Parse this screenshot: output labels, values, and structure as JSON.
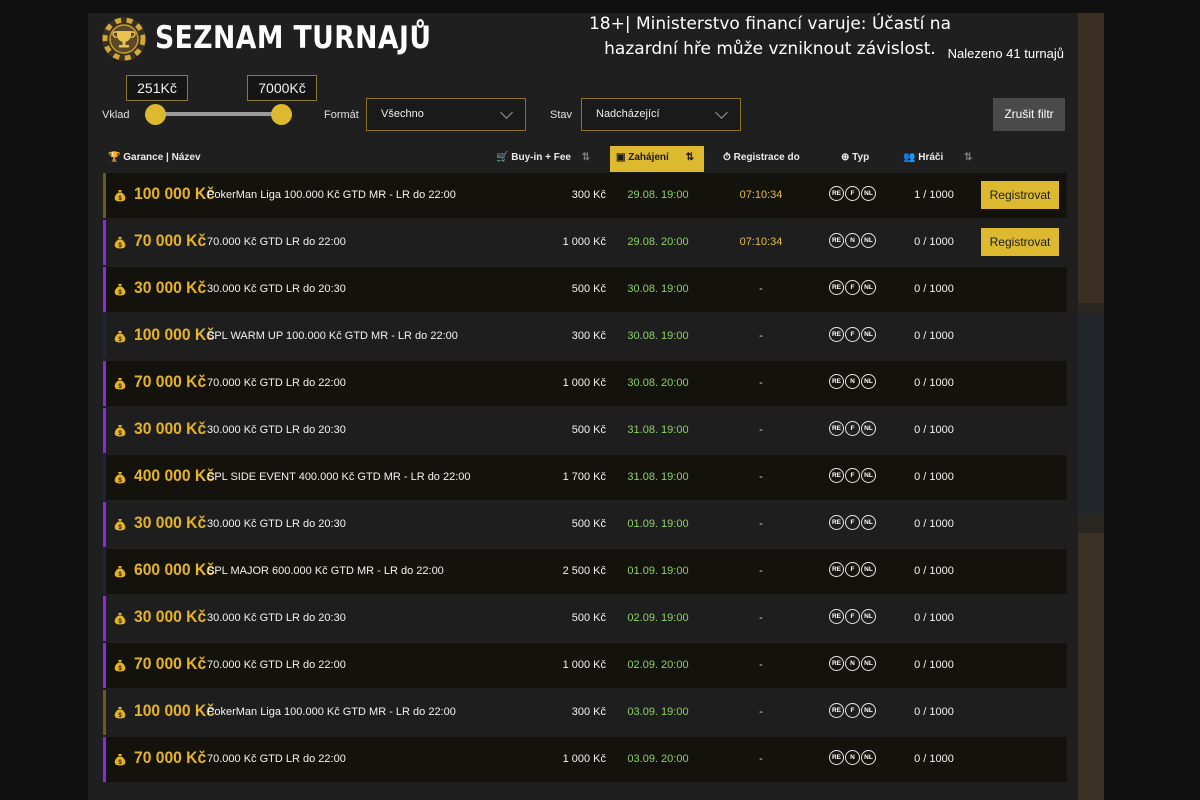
{
  "header": {
    "title": "SEZNAM TURNAJŮ",
    "warning": "18+| Ministerstvo financí varuje: Účastí na hazardní hře může vzniknout závislost.",
    "found": "Nalezeno 41 turnajů"
  },
  "filters": {
    "min_price": "251Kč",
    "max_price": "7000Kč",
    "deposit_label": "Vklad",
    "format_label": "Formát",
    "format_value": "Všechno",
    "status_label": "Stav",
    "status_value": "Nadcházející",
    "clear_button": "Zrušit filtr"
  },
  "table": {
    "headers": {
      "name": "Garance | Název",
      "buyin": "Buy-in + Fee",
      "start": "Zahájení",
      "reg": "Registrace do",
      "type": "Typ",
      "players": "Hráči"
    },
    "register_label": "Registrovat",
    "rows": [
      {
        "amount": "100 000 Kč",
        "name": "PokerMan Liga 100.000 Kč GTD MR - LR do 22:00",
        "buyin": "300 Kč",
        "start": "29.08. 19:00",
        "reg_until": "07:10:34",
        "types": [
          "RE",
          "F",
          "NL"
        ],
        "players": "1 / 1000",
        "register": true,
        "stripe": "gold"
      },
      {
        "amount": "70 000 Kč",
        "name": "70.000 Kč GTD LR do 22:00",
        "buyin": "1 000 Kč",
        "start": "29.08. 20:00",
        "reg_until": "07:10:34",
        "types": [
          "RE",
          "N",
          "NL"
        ],
        "players": "0 / 1000",
        "register": true,
        "stripe": "purple"
      },
      {
        "amount": "30 000 Kč",
        "name": "30.000 Kč GTD LR do 20:30",
        "buyin": "500 Kč",
        "start": "30.08. 19:00",
        "reg_until": "-",
        "types": [
          "RE",
          "F",
          "NL"
        ],
        "players": "0 / 1000",
        "register": false,
        "stripe": "purple"
      },
      {
        "amount": "100 000 Kč",
        "name": "SPL WARM UP 100.000 Kč GTD MR - LR do 22:00",
        "buyin": "300 Kč",
        "start": "30.08. 19:00",
        "reg_until": "-",
        "types": [
          "RE",
          "F",
          "NL"
        ],
        "players": "0 / 1000",
        "register": false,
        "stripe": "navy"
      },
      {
        "amount": "70 000 Kč",
        "name": "70.000 Kč GTD LR do 22:00",
        "buyin": "1 000 Kč",
        "start": "30.08. 20:00",
        "reg_until": "-",
        "types": [
          "RE",
          "N",
          "NL"
        ],
        "players": "0 / 1000",
        "register": false,
        "stripe": "purple"
      },
      {
        "amount": "30 000 Kč",
        "name": "30.000 Kč GTD LR do 20:30",
        "buyin": "500 Kč",
        "start": "31.08. 19:00",
        "reg_until": "-",
        "types": [
          "RE",
          "F",
          "NL"
        ],
        "players": "0 / 1000",
        "register": false,
        "stripe": "purple"
      },
      {
        "amount": "400 000 Kč",
        "name": "SPL SIDE EVENT 400.000 Kč GTD MR - LR do 22:00",
        "buyin": "1 700 Kč",
        "start": "31.08. 19:00",
        "reg_until": "-",
        "types": [
          "RE",
          "F",
          "NL"
        ],
        "players": "0 / 1000",
        "register": false,
        "stripe": "navy"
      },
      {
        "amount": "30 000 Kč",
        "name": "30.000 Kč GTD LR do 20:30",
        "buyin": "500 Kč",
        "start": "01.09. 19:00",
        "reg_until": "-",
        "types": [
          "RE",
          "F",
          "NL"
        ],
        "players": "0 / 1000",
        "register": false,
        "stripe": "purple"
      },
      {
        "amount": "600 000 Kč",
        "name": "SPL MAJOR 600.000 Kč GTD MR - LR do 22:00",
        "buyin": "2 500 Kč",
        "start": "01.09. 19:00",
        "reg_until": "-",
        "types": [
          "RE",
          "F",
          "NL"
        ],
        "players": "0 / 1000",
        "register": false,
        "stripe": "navy"
      },
      {
        "amount": "30 000 Kč",
        "name": "30.000 Kč GTD LR do 20:30",
        "buyin": "500 Kč",
        "start": "02.09. 19:00",
        "reg_until": "-",
        "types": [
          "RE",
          "F",
          "NL"
        ],
        "players": "0 / 1000",
        "register": false,
        "stripe": "purple"
      },
      {
        "amount": "70 000 Kč",
        "name": "70.000 Kč GTD LR do 22:00",
        "buyin": "1 000 Kč",
        "start": "02.09. 20:00",
        "reg_until": "-",
        "types": [
          "RE",
          "N",
          "NL"
        ],
        "players": "0 / 1000",
        "register": false,
        "stripe": "purple"
      },
      {
        "amount": "100 000 Kč",
        "name": "PokerMan Liga 100.000 Kč GTD MR - LR do 22:00",
        "buyin": "300 Kč",
        "start": "03.09. 19:00",
        "reg_until": "-",
        "types": [
          "RE",
          "F",
          "NL"
        ],
        "players": "0 / 1000",
        "register": false,
        "stripe": "gold"
      },
      {
        "amount": "70 000 Kč",
        "name": "70.000 Kč GTD LR do 22:00",
        "buyin": "1 000 Kč",
        "start": "03.09. 20:00",
        "reg_until": "-",
        "types": [
          "RE",
          "N",
          "NL"
        ],
        "players": "0 / 1000",
        "register": false,
        "stripe": "purple"
      }
    ]
  },
  "colors": {
    "accent": "#dcb92e",
    "amount": "#e6b422",
    "date": "#8ecf67",
    "purple_stripe": "#8a2be2"
  }
}
